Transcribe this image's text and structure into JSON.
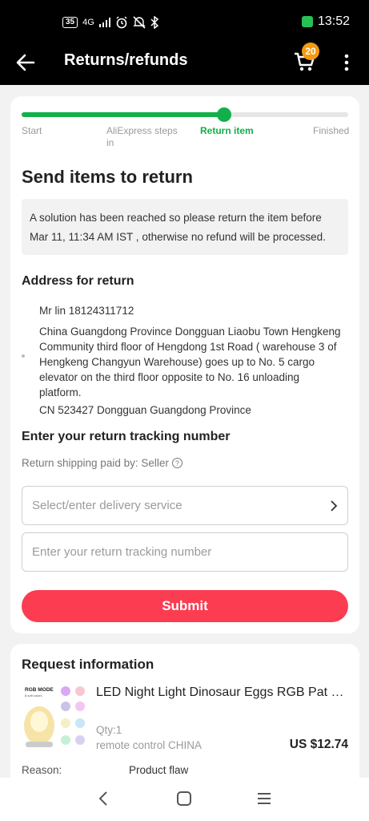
{
  "status_bar": {
    "battery": "35",
    "network": "4G",
    "time": "13:52"
  },
  "app_bar": {
    "title": "Returns/refunds",
    "cart_count": "20"
  },
  "progress": {
    "steps": [
      "Start",
      "AliExpress steps in",
      "Return item",
      "Finished"
    ],
    "active_step": 2,
    "fraction": 0.62
  },
  "send": {
    "heading": "Send items to return",
    "notice": "A solution has been reached so please return the item before Mar 11, 11:34 AM IST , otherwise no refund will be processed."
  },
  "address": {
    "heading": "Address for return",
    "contact": "Mr lin 18124311712",
    "street": "China Guangdong Province Dongguan Liaobu Town Hengkeng Community third floor of Hengdong 1st Road ( warehouse 3 of Hengkeng Changyun Warehouse) goes up to No. 5 cargo elevator on the third floor opposite to No. 16 unloading platform.",
    "postal": "CN 523427 Dongguan Guangdong Province"
  },
  "tracking": {
    "heading": "Enter your return tracking number",
    "paid_by": "Return shipping paid by: Seller",
    "delivery_placeholder": "Select/enter delivery service",
    "tracking_placeholder": "Enter your return tracking number",
    "submit_label": "Submit"
  },
  "request": {
    "heading": "Request information",
    "product_name": "LED Night Light Dinosaur Eggs RGB Pat Li...",
    "thumb_text": "RGB MODE",
    "thumb_subtext": "8 soft colors",
    "qty": "Qty:1",
    "variant": "remote control CHINA",
    "price": "US $12.74",
    "reason_label": "Reason:",
    "reason_value": "Product flaw"
  },
  "colors": {
    "accent_green": "#12b04a",
    "submit_red": "#fc3c51",
    "cart_badge": "#f59a12"
  }
}
